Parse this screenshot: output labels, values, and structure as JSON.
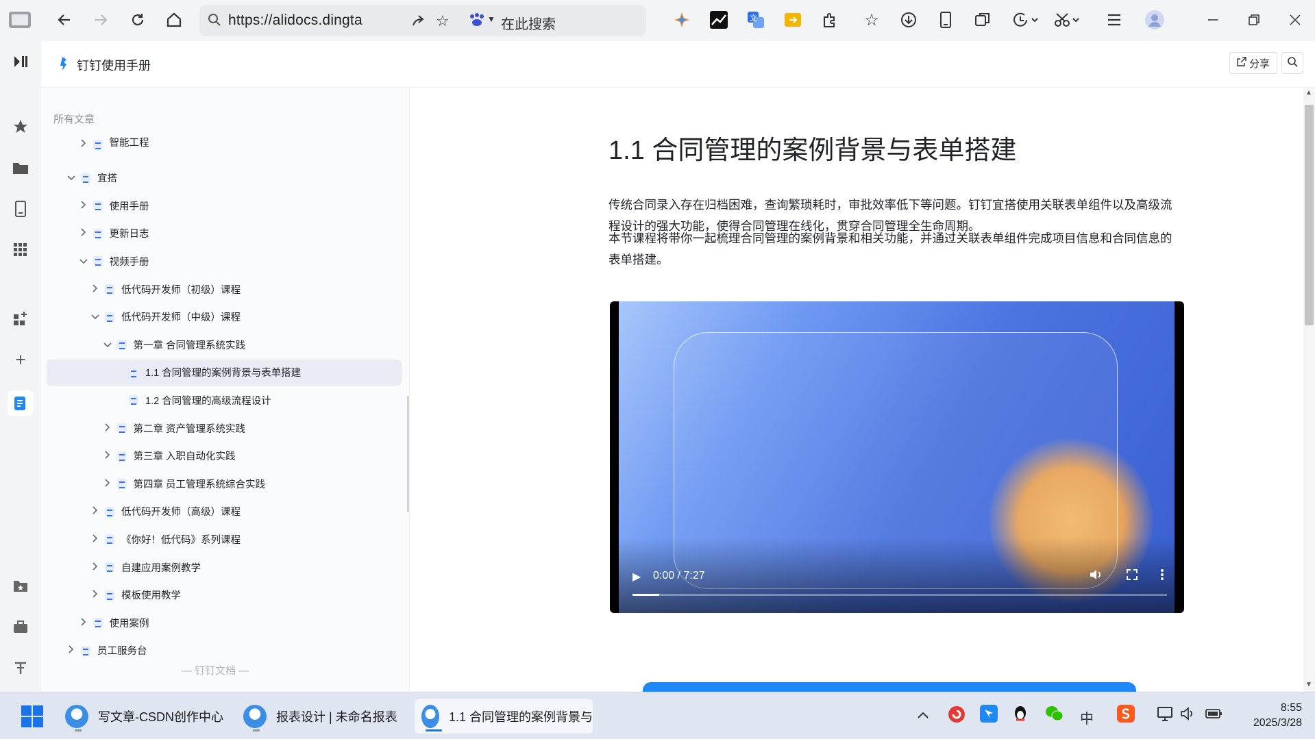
{
  "browser": {
    "url": "https://alidocs.dingta",
    "search_placeholder": "在此搜索"
  },
  "doc_header": {
    "title": "钉钉使用手册",
    "share_label": "分享"
  },
  "sidenav": {
    "heading": "所有文章",
    "items": [
      {
        "label": "智能工程",
        "level": 2,
        "expanded": false
      },
      {
        "label": "宜搭",
        "level": 1,
        "expanded": true
      },
      {
        "label": "使用手册",
        "level": 2,
        "expanded": false
      },
      {
        "label": "更新日志",
        "level": 2,
        "expanded": false
      },
      {
        "label": "视频手册",
        "level": 2,
        "expanded": true
      },
      {
        "label": "低代码开发师（初级）课程",
        "level": 3,
        "expanded": false
      },
      {
        "label": "低代码开发师（中级）课程",
        "level": 3,
        "expanded": true
      },
      {
        "label": "第一章 合同管理系统实践",
        "level": 4,
        "expanded": true
      },
      {
        "label": "1.1 合同管理的案例背景与表单搭建",
        "level": 5,
        "active": true
      },
      {
        "label": "1.2 合同管理的高级流程设计",
        "level": 5
      },
      {
        "label": "第二章 资产管理系统实践",
        "level": 4,
        "expanded": false
      },
      {
        "label": "第三章 入职自动化实践",
        "level": 4,
        "expanded": false
      },
      {
        "label": "第四章 员工管理系统综合实践",
        "level": 4,
        "expanded": false
      },
      {
        "label": "低代码开发师（高级）课程",
        "level": 3,
        "expanded": false
      },
      {
        "label": "《你好！低代码》系列课程",
        "level": 3,
        "expanded": false
      },
      {
        "label": "自建应用案例教学",
        "level": 3,
        "expanded": false
      },
      {
        "label": "模板使用教学",
        "level": 3,
        "expanded": false
      },
      {
        "label": "使用案例",
        "level": 2,
        "expanded": false
      },
      {
        "label": "员工服务台",
        "level": 1,
        "expanded": false
      }
    ],
    "footer": "钉钉文档"
  },
  "article": {
    "title": "1.1 合同管理的案例背景与表单搭建",
    "para1": "传统合同录入存在归档困难，查询繁琐耗时，审批效率低下等问题。钉钉宜搭使用关联表单组件以及高级流程设计的强大功能，使得合同管理在线化，贯穿合同管理全生命周期。",
    "para2": "本节课程将带你一起梳理合同管理的案例背景和相关功能，并通过关联表单组件完成项目信息和合同信息的表单搭建。",
    "video": {
      "time": "0:00 / 7:27",
      "progress": 0.05
    }
  },
  "taskbar": {
    "apps": [
      {
        "label": "写文章-CSDN创作中心"
      },
      {
        "label": "报表设计 | 未命名报表"
      },
      {
        "label": "1.1 合同管理的案例背景与"
      }
    ],
    "ime": "中",
    "time": "8:55",
    "date": "2025/3/28"
  }
}
